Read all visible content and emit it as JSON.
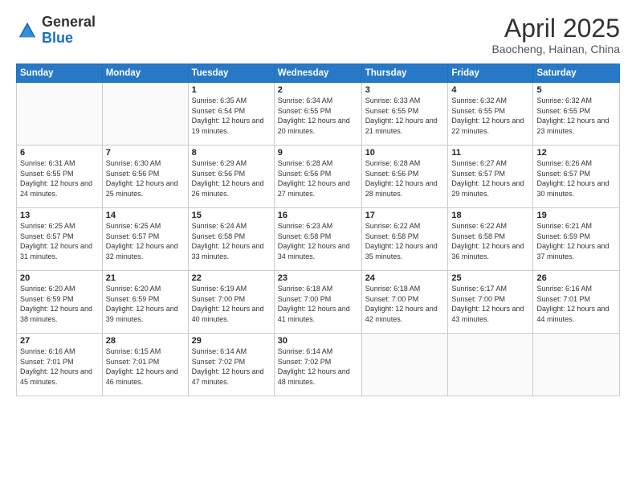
{
  "header": {
    "logo_line1": "General",
    "logo_line2": "Blue",
    "title": "April 2025",
    "subtitle": "Baocheng, Hainan, China"
  },
  "days_of_week": [
    "Sunday",
    "Monday",
    "Tuesday",
    "Wednesday",
    "Thursday",
    "Friday",
    "Saturday"
  ],
  "weeks": [
    [
      {
        "day": "",
        "sunrise": "",
        "sunset": "",
        "daylight": ""
      },
      {
        "day": "",
        "sunrise": "",
        "sunset": "",
        "daylight": ""
      },
      {
        "day": "1",
        "sunrise": "Sunrise: 6:35 AM",
        "sunset": "Sunset: 6:54 PM",
        "daylight": "Daylight: 12 hours and 19 minutes."
      },
      {
        "day": "2",
        "sunrise": "Sunrise: 6:34 AM",
        "sunset": "Sunset: 6:55 PM",
        "daylight": "Daylight: 12 hours and 20 minutes."
      },
      {
        "day": "3",
        "sunrise": "Sunrise: 6:33 AM",
        "sunset": "Sunset: 6:55 PM",
        "daylight": "Daylight: 12 hours and 21 minutes."
      },
      {
        "day": "4",
        "sunrise": "Sunrise: 6:32 AM",
        "sunset": "Sunset: 6:55 PM",
        "daylight": "Daylight: 12 hours and 22 minutes."
      },
      {
        "day": "5",
        "sunrise": "Sunrise: 6:32 AM",
        "sunset": "Sunset: 6:55 PM",
        "daylight": "Daylight: 12 hours and 23 minutes."
      }
    ],
    [
      {
        "day": "6",
        "sunrise": "Sunrise: 6:31 AM",
        "sunset": "Sunset: 6:55 PM",
        "daylight": "Daylight: 12 hours and 24 minutes."
      },
      {
        "day": "7",
        "sunrise": "Sunrise: 6:30 AM",
        "sunset": "Sunset: 6:56 PM",
        "daylight": "Daylight: 12 hours and 25 minutes."
      },
      {
        "day": "8",
        "sunrise": "Sunrise: 6:29 AM",
        "sunset": "Sunset: 6:56 PM",
        "daylight": "Daylight: 12 hours and 26 minutes."
      },
      {
        "day": "9",
        "sunrise": "Sunrise: 6:28 AM",
        "sunset": "Sunset: 6:56 PM",
        "daylight": "Daylight: 12 hours and 27 minutes."
      },
      {
        "day": "10",
        "sunrise": "Sunrise: 6:28 AM",
        "sunset": "Sunset: 6:56 PM",
        "daylight": "Daylight: 12 hours and 28 minutes."
      },
      {
        "day": "11",
        "sunrise": "Sunrise: 6:27 AM",
        "sunset": "Sunset: 6:57 PM",
        "daylight": "Daylight: 12 hours and 29 minutes."
      },
      {
        "day": "12",
        "sunrise": "Sunrise: 6:26 AM",
        "sunset": "Sunset: 6:57 PM",
        "daylight": "Daylight: 12 hours and 30 minutes."
      }
    ],
    [
      {
        "day": "13",
        "sunrise": "Sunrise: 6:25 AM",
        "sunset": "Sunset: 6:57 PM",
        "daylight": "Daylight: 12 hours and 31 minutes."
      },
      {
        "day": "14",
        "sunrise": "Sunrise: 6:25 AM",
        "sunset": "Sunset: 6:57 PM",
        "daylight": "Daylight: 12 hours and 32 minutes."
      },
      {
        "day": "15",
        "sunrise": "Sunrise: 6:24 AM",
        "sunset": "Sunset: 6:58 PM",
        "daylight": "Daylight: 12 hours and 33 minutes."
      },
      {
        "day": "16",
        "sunrise": "Sunrise: 6:23 AM",
        "sunset": "Sunset: 6:58 PM",
        "daylight": "Daylight: 12 hours and 34 minutes."
      },
      {
        "day": "17",
        "sunrise": "Sunrise: 6:22 AM",
        "sunset": "Sunset: 6:58 PM",
        "daylight": "Daylight: 12 hours and 35 minutes."
      },
      {
        "day": "18",
        "sunrise": "Sunrise: 6:22 AM",
        "sunset": "Sunset: 6:58 PM",
        "daylight": "Daylight: 12 hours and 36 minutes."
      },
      {
        "day": "19",
        "sunrise": "Sunrise: 6:21 AM",
        "sunset": "Sunset: 6:59 PM",
        "daylight": "Daylight: 12 hours and 37 minutes."
      }
    ],
    [
      {
        "day": "20",
        "sunrise": "Sunrise: 6:20 AM",
        "sunset": "Sunset: 6:59 PM",
        "daylight": "Daylight: 12 hours and 38 minutes."
      },
      {
        "day": "21",
        "sunrise": "Sunrise: 6:20 AM",
        "sunset": "Sunset: 6:59 PM",
        "daylight": "Daylight: 12 hours and 39 minutes."
      },
      {
        "day": "22",
        "sunrise": "Sunrise: 6:19 AM",
        "sunset": "Sunset: 7:00 PM",
        "daylight": "Daylight: 12 hours and 40 minutes."
      },
      {
        "day": "23",
        "sunrise": "Sunrise: 6:18 AM",
        "sunset": "Sunset: 7:00 PM",
        "daylight": "Daylight: 12 hours and 41 minutes."
      },
      {
        "day": "24",
        "sunrise": "Sunrise: 6:18 AM",
        "sunset": "Sunset: 7:00 PM",
        "daylight": "Daylight: 12 hours and 42 minutes."
      },
      {
        "day": "25",
        "sunrise": "Sunrise: 6:17 AM",
        "sunset": "Sunset: 7:00 PM",
        "daylight": "Daylight: 12 hours and 43 minutes."
      },
      {
        "day": "26",
        "sunrise": "Sunrise: 6:16 AM",
        "sunset": "Sunset: 7:01 PM",
        "daylight": "Daylight: 12 hours and 44 minutes."
      }
    ],
    [
      {
        "day": "27",
        "sunrise": "Sunrise: 6:16 AM",
        "sunset": "Sunset: 7:01 PM",
        "daylight": "Daylight: 12 hours and 45 minutes."
      },
      {
        "day": "28",
        "sunrise": "Sunrise: 6:15 AM",
        "sunset": "Sunset: 7:01 PM",
        "daylight": "Daylight: 12 hours and 46 minutes."
      },
      {
        "day": "29",
        "sunrise": "Sunrise: 6:14 AM",
        "sunset": "Sunset: 7:02 PM",
        "daylight": "Daylight: 12 hours and 47 minutes."
      },
      {
        "day": "30",
        "sunrise": "Sunrise: 6:14 AM",
        "sunset": "Sunset: 7:02 PM",
        "daylight": "Daylight: 12 hours and 48 minutes."
      },
      {
        "day": "",
        "sunrise": "",
        "sunset": "",
        "daylight": ""
      },
      {
        "day": "",
        "sunrise": "",
        "sunset": "",
        "daylight": ""
      },
      {
        "day": "",
        "sunrise": "",
        "sunset": "",
        "daylight": ""
      }
    ]
  ]
}
